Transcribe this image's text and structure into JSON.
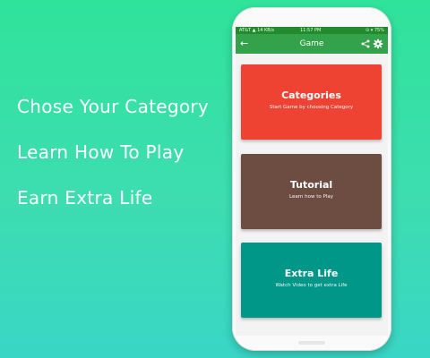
{
  "promo": {
    "lines": [
      "Chose Your Category",
      "Learn How To Play",
      "Earn Extra Life"
    ]
  },
  "status_bar": {
    "left": "AT&T ▲ 14 KB/s",
    "time": "11:57 PM",
    "right": "⊙ ▾ 75%"
  },
  "app_bar": {
    "title": "Game",
    "back_icon": "←"
  },
  "cards": [
    {
      "title": "Categories",
      "subtitle": "Start Game by choosing Category",
      "color": "#ee4333"
    },
    {
      "title": "Tutorial",
      "subtitle": "Learn how to Play",
      "color": "#6d4c41"
    },
    {
      "title": "Extra Life",
      "subtitle": "Watch Video to get extra Life",
      "color": "#009688"
    }
  ],
  "colors": {
    "status_bar": "#238a2e",
    "app_bar": "#33a24a",
    "background_gradient": [
      "#2fe39a",
      "#39d6c5"
    ]
  }
}
